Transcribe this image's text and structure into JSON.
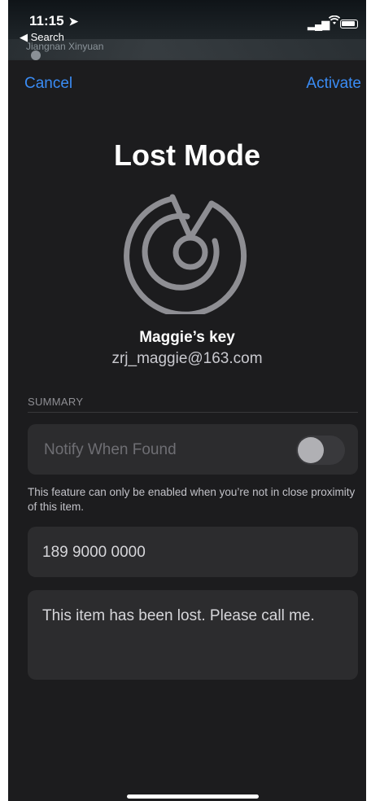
{
  "status_bar": {
    "time": "11:15",
    "back_app": "◀ Search",
    "map_label": "Jiangnan Xinyuan"
  },
  "nav": {
    "cancel": "Cancel",
    "activate": "Activate"
  },
  "title": "Lost Mode",
  "item": {
    "name": "Maggie’s key",
    "email": "zrj_maggie@163.com"
  },
  "summary": {
    "section_title": "SUMMARY",
    "notify_label": "Notify When Found",
    "notify_enabled": false,
    "footnote": "This feature can only be enabled when you’re not in close proximity of this item.",
    "phone_number": "189 9000 0000",
    "message": "This item has been lost. Please call me."
  },
  "colors": {
    "accent": "#3a8cf5",
    "background": "#1c1c1e",
    "card": "#2c2c2e"
  },
  "icons": [
    "location-arrow-icon",
    "signal-icon",
    "wifi-icon",
    "battery-icon",
    "radar-icon"
  ]
}
